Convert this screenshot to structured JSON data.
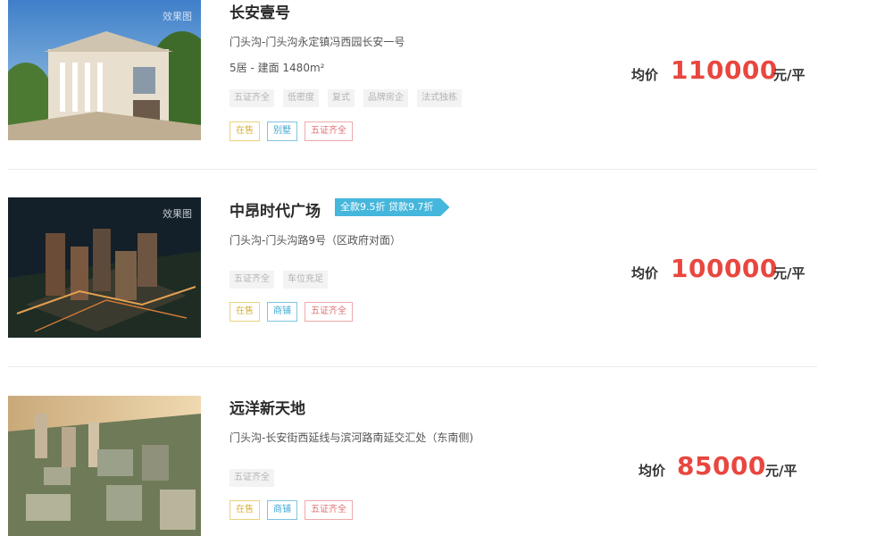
{
  "listings": [
    {
      "thumb_badge": "效果图",
      "title": "长安壹号",
      "address": "门头沟-门头沟永定镇冯西园长安一号",
      "spec": "5居 - 建面 1480m²",
      "features": [
        "五证齐全",
        "低密度",
        "复式",
        "品牌房企",
        "法式独栋"
      ],
      "statuses": [
        "在售",
        "别墅",
        "五证齐全"
      ],
      "price_label": "均价",
      "price_value": "110000",
      "price_unit": "元/平"
    },
    {
      "thumb_badge": "效果图",
      "title": "中昂时代广场",
      "discount": "全款9.5折 贷款9.7折",
      "address": "门头沟-门头沟路9号（区政府对面）",
      "features": [
        "五证齐全",
        "车位充足"
      ],
      "statuses": [
        "在售",
        "商铺",
        "五证齐全"
      ],
      "price_label": "均价",
      "price_value": "100000",
      "price_unit": "元/平"
    },
    {
      "title": "远洋新天地",
      "address": "门头沟-长安街西延线与滨河路南延交汇处（东南侧)",
      "features": [
        "五证齐全"
      ],
      "statuses": [
        "在售",
        "商铺",
        "五证齐全"
      ],
      "price_label": "均价",
      "price_value": "85000",
      "price_unit": "元/平"
    }
  ],
  "colors": {
    "price": "#e8473f",
    "discount_bg": "#45b6dc",
    "status_yellow": "#d6b53a",
    "status_blue": "#3fa7d3",
    "status_red": "#e07070"
  }
}
